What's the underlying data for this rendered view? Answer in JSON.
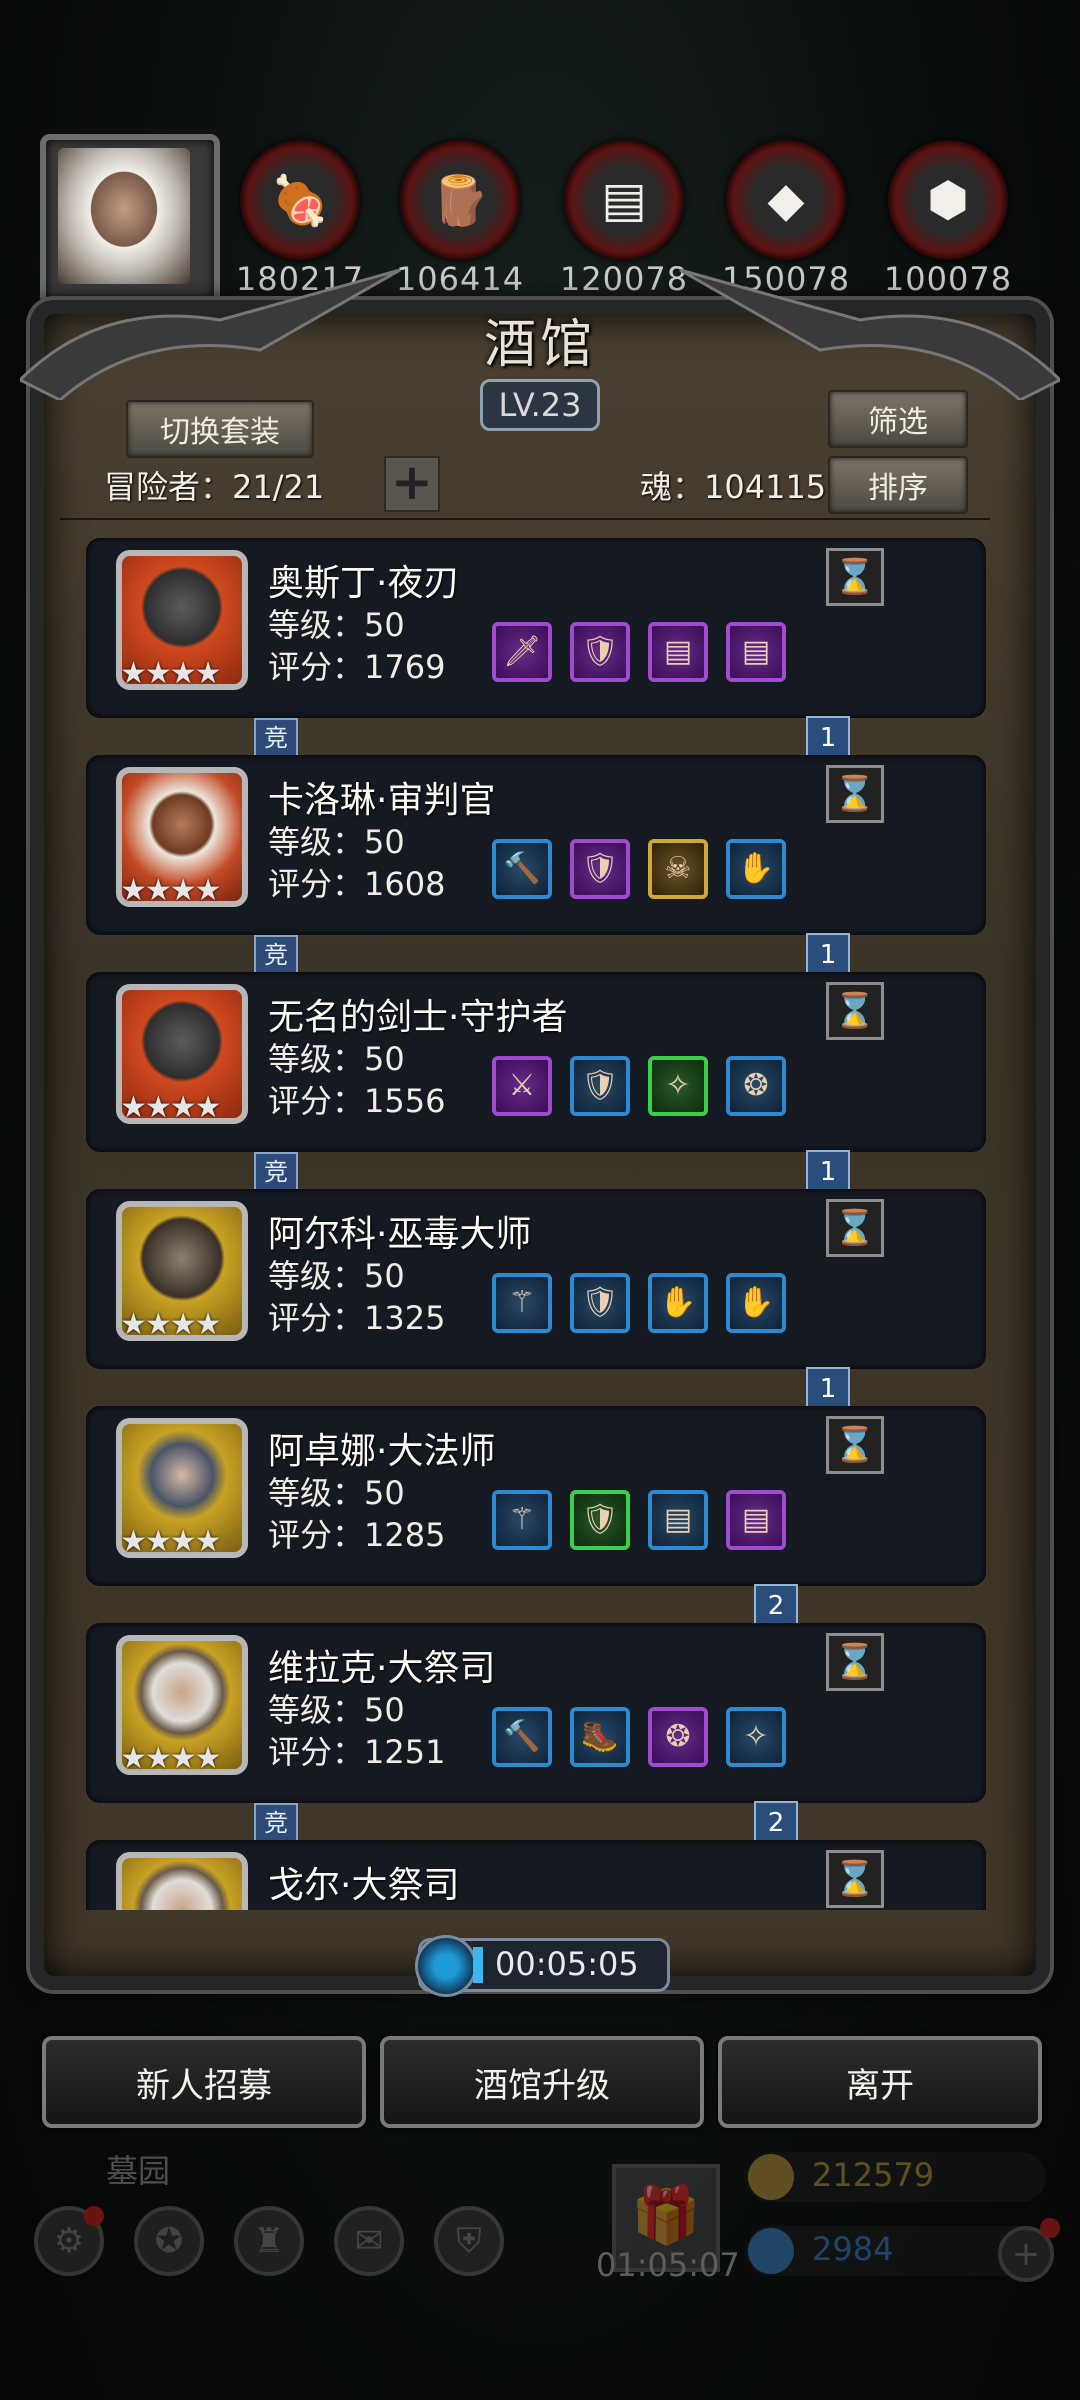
{
  "resources": [
    {
      "icon": "meat-icon",
      "glyph": "🍖",
      "count": "180217"
    },
    {
      "icon": "wood-icon",
      "glyph": "🪵",
      "count": "106414"
    },
    {
      "icon": "iron-icon",
      "glyph": "▤",
      "count": "120078"
    },
    {
      "icon": "crystal-icon",
      "glyph": "◆",
      "count": "150078"
    },
    {
      "icon": "stone-icon",
      "glyph": "⬢",
      "count": "100078"
    }
  ],
  "panel": {
    "title": "酒馆",
    "level": "LV.23",
    "switch_outfit": "切换套装",
    "filter": "筛选",
    "sort": "排序",
    "adventurers_label": "冒险者：21/21",
    "soul_label": "魂：104115",
    "plus": "+"
  },
  "heroes": [
    {
      "name": "奥斯丁·夜刃",
      "level": "等级：50",
      "score": "评分：1769",
      "stars": "★★★★",
      "frame": "red",
      "gear": [
        {
          "c": "purple",
          "g": "🗡"
        },
        {
          "c": "purple",
          "g": "🛡"
        },
        {
          "c": "purple",
          "g": "▤"
        },
        {
          "c": "purple",
          "g": "▤"
        }
      ],
      "jing": "竞",
      "ribbon": "1"
    },
    {
      "name": "卡洛琳·审判官",
      "level": "等级：50",
      "score": "评分：1608",
      "stars": "★★★★",
      "frame": "red2",
      "gear": [
        {
          "c": "blue",
          "g": "🔨"
        },
        {
          "c": "purple",
          "g": "🛡"
        },
        {
          "c": "gold",
          "g": "☠"
        },
        {
          "c": "blue",
          "g": "✋"
        }
      ],
      "jing": "竞",
      "ribbon": "1"
    },
    {
      "name": "无名的剑士·守护者",
      "level": "等级：50",
      "score": "评分：1556",
      "stars": "★★★★",
      "frame": "red",
      "gear": [
        {
          "c": "purple",
          "g": "⚔"
        },
        {
          "c": "blue",
          "g": "🛡"
        },
        {
          "c": "green",
          "g": "✧"
        },
        {
          "c": "blue",
          "g": "❂"
        }
      ],
      "jing": "竞",
      "ribbon": "1"
    },
    {
      "name": "阿尔科·巫毒大师",
      "level": "等级：50",
      "score": "评分：1325",
      "stars": "★★★★",
      "frame": "gold",
      "gear": [
        {
          "c": "blue",
          "g": "⚚"
        },
        {
          "c": "blue",
          "g": "🛡"
        },
        {
          "c": "blue",
          "g": "✋"
        },
        {
          "c": "blue",
          "g": "✋"
        }
      ],
      "jing": "",
      "ribbon": "1"
    },
    {
      "name": "阿卓娜·大法师",
      "level": "等级：50",
      "score": "评分：1285",
      "stars": "★★★★",
      "frame": "gold2",
      "gear": [
        {
          "c": "blue",
          "g": "⚚"
        },
        {
          "c": "green",
          "g": "🛡"
        },
        {
          "c": "blue",
          "g": "▤"
        },
        {
          "c": "purple",
          "g": "▤"
        }
      ],
      "jing": "",
      "ribbon": "2"
    },
    {
      "name": "维拉克·大祭司",
      "level": "等级：50",
      "score": "评分：1251",
      "stars": "★★★★",
      "frame": "gold3",
      "gear": [
        {
          "c": "blue",
          "g": "🔨"
        },
        {
          "c": "blue",
          "g": "🥾"
        },
        {
          "c": "purple",
          "g": "❂"
        },
        {
          "c": "blue",
          "g": "✧"
        }
      ],
      "jing": "竞",
      "ribbon": "2"
    },
    {
      "name": "戈尔·大祭司",
      "level": "",
      "score": "",
      "stars": "",
      "frame": "gold3",
      "gear": [],
      "jing": "",
      "ribbon": ""
    }
  ],
  "timer": "00:05:05",
  "buttons": {
    "recruit": "新人招募",
    "upgrade": "酒馆升级",
    "leave": "离开"
  },
  "background_hud": {
    "area_label": "墓园",
    "gift_timer": "01:05:07",
    "gold": "212579",
    "gems": "2984"
  },
  "colors": {
    "gold_text": "#c8a040",
    "gem_text": "#3a8ad8",
    "accent_blue": "#2a4e7c"
  }
}
